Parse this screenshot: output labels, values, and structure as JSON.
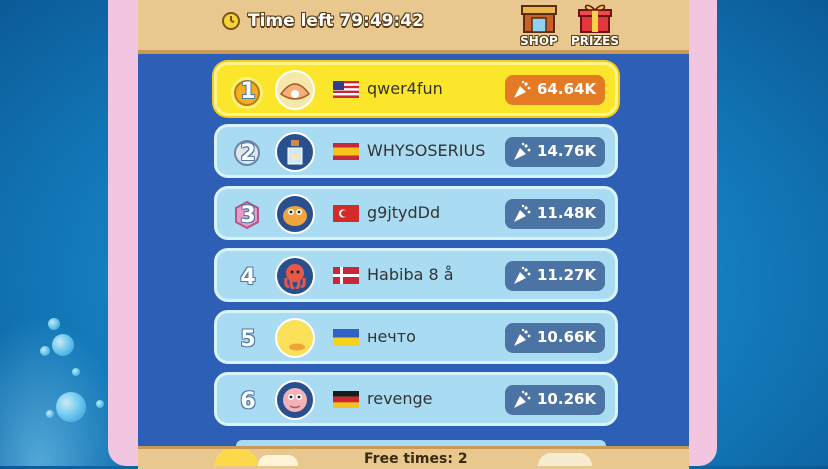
{
  "header": {
    "time_left": "Time left 79:49:42",
    "shop_label": "SHOP",
    "prizes_label": "PRIZES"
  },
  "leaderboard": [
    {
      "rank": "1",
      "name": "qwer4fun",
      "score": "64.64K",
      "flag": "us-flag",
      "avatar": "clam-avatar"
    },
    {
      "rank": "2",
      "name": "WHYSOSERIUS",
      "score": "14.76K",
      "flag": "spain-flag",
      "avatar": "bottle-avatar"
    },
    {
      "rank": "3",
      "name": "g9jtydDd",
      "score": "11.48K",
      "flag": "turkey-flag",
      "avatar": "pufferfish-avatar"
    },
    {
      "rank": "4",
      "name": "Habiba 8 å",
      "score": "11.27K",
      "flag": "denmark-flag",
      "avatar": "octopus-avatar"
    },
    {
      "rank": "5",
      "name": "нечто",
      "score": "10.66K",
      "flag": "ukraine-flag",
      "avatar": "duck-avatar"
    },
    {
      "rank": "6",
      "name": "revenge",
      "score": "10.26K",
      "flag": "germany-flag",
      "avatar": "axolotl-avatar"
    }
  ],
  "footer": {
    "free_times": "Free times: 2"
  },
  "colors": {
    "panel_blue": "#2e5fb6",
    "row_blue": "#a9dcf2",
    "first_row_yellow": "#fbe62c",
    "score_blue": "#4b73a3",
    "score_orange": "#e57a25",
    "frame_pink": "#f2c6e0",
    "header_tan": "#e8c88f"
  }
}
